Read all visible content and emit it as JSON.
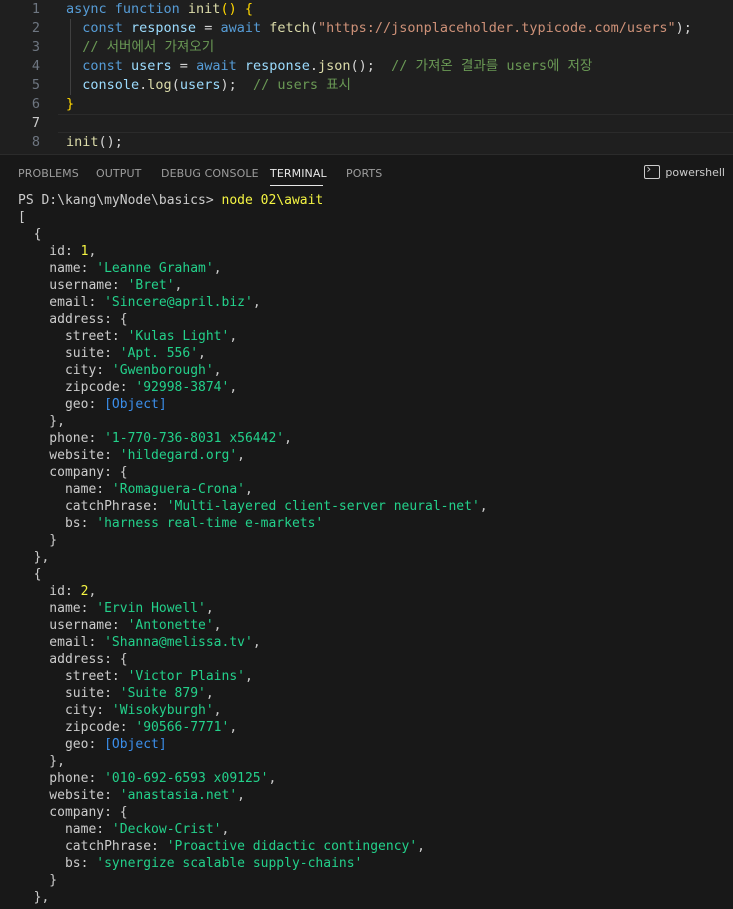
{
  "editor": {
    "lines": [
      {
        "num": "1",
        "parts": [
          [
            "k",
            "async function "
          ],
          [
            "f",
            "init"
          ],
          [
            "p",
            "() {"
          ]
        ]
      },
      {
        "num": "2",
        "parts": [
          [
            "k",
            "  const "
          ],
          [
            "v",
            "response"
          ],
          [
            "o",
            " = "
          ],
          [
            "k",
            "await "
          ],
          [
            "f",
            "fetch"
          ],
          [
            "o",
            "("
          ],
          [
            "s",
            "\"https://jsonplaceholder.typicode.com/users\""
          ],
          [
            "o",
            ");"
          ]
        ]
      },
      {
        "num": "3",
        "parts": [
          [
            "c",
            "  // 서버에서 가져오기"
          ]
        ]
      },
      {
        "num": "4",
        "parts": [
          [
            "k",
            "  const "
          ],
          [
            "v",
            "users"
          ],
          [
            "o",
            " = "
          ],
          [
            "k",
            "await "
          ],
          [
            "v",
            "response"
          ],
          [
            "o",
            "."
          ],
          [
            "f",
            "json"
          ],
          [
            "o",
            "();  "
          ],
          [
            "c",
            "// 가져온 결과를 users에 저장"
          ]
        ]
      },
      {
        "num": "5",
        "parts": [
          [
            "v",
            "  console"
          ],
          [
            "o",
            "."
          ],
          [
            "f",
            "log"
          ],
          [
            "o",
            "("
          ],
          [
            "v",
            "users"
          ],
          [
            "o",
            ");  "
          ],
          [
            "c",
            "// users 표시"
          ]
        ]
      },
      {
        "num": "6",
        "parts": [
          [
            "p",
            "}"
          ]
        ]
      },
      {
        "num": "7",
        "parts": []
      },
      {
        "num": "8",
        "parts": [
          [
            "f",
            "init"
          ],
          [
            "o",
            "();"
          ]
        ]
      }
    ]
  },
  "panel": {
    "tabs": [
      "PROBLEMS",
      "OUTPUT",
      "DEBUG CONSOLE",
      "TERMINAL",
      "PORTS"
    ],
    "active_tab": "TERMINAL",
    "shell_label": "powershell",
    "icon": "terminal-icon"
  },
  "terminal": {
    "prompt": "PS D:\\kang\\myNode\\basics> ",
    "command": "node 02\\await",
    "users": [
      {
        "id": "1",
        "name": "'Leanne Graham'",
        "username": "'Bret'",
        "email": "'Sincere@april.biz'",
        "street": "'Kulas Light'",
        "suite": "'Apt. 556'",
        "city": "'Gwenborough'",
        "zipcode": "'92998-3874'",
        "geo": "[Object]",
        "phone": "'1-770-736-8031 x56442'",
        "website": "'hildegard.org'",
        "company_name": "'Romaguera-Crona'",
        "catchPhrase": "'Multi-layered client-server neural-net'",
        "bs": "'harness real-time e-markets'"
      },
      {
        "id": "2",
        "name": "'Ervin Howell'",
        "username": "'Antonette'",
        "email": "'Shanna@melissa.tv'",
        "street": "'Victor Plains'",
        "suite": "'Suite 879'",
        "city": "'Wisokyburgh'",
        "zipcode": "'90566-7771'",
        "geo": "[Object]",
        "phone": "'010-692-6593 x09125'",
        "website": "'anastasia.net'",
        "company_name": "'Deckow-Crist'",
        "catchPhrase": "'Proactive didactic contingency'",
        "bs": "'synergize scalable supply-chains'"
      }
    ]
  }
}
